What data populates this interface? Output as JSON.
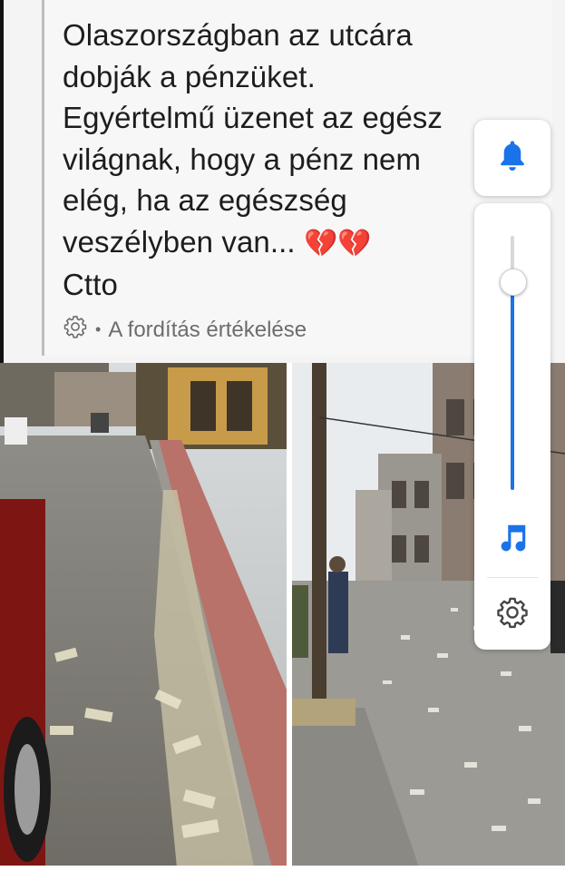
{
  "post": {
    "text": "Olaszországban az utcára\ndobják a pénzüket.\nEgyértelmű üzenet az egész\nvilágnak, hogy a pénz nem\nelég, ha az egészség\nveszélyben van...",
    "emoji": "💔💔",
    "credit": "Ctto",
    "rate_translation": "A fordítás értékelése",
    "separator": "•"
  },
  "icons": {
    "settings_small": "gear-icon",
    "bell": "bell-icon",
    "music": "music-note-icon",
    "settings": "gear-icon"
  },
  "volume": {
    "level": 0.82
  },
  "colors": {
    "accent": "#1a73e8",
    "text": "#1d1d1d",
    "muted": "#6d6d6d",
    "heart": "#c8233a"
  }
}
